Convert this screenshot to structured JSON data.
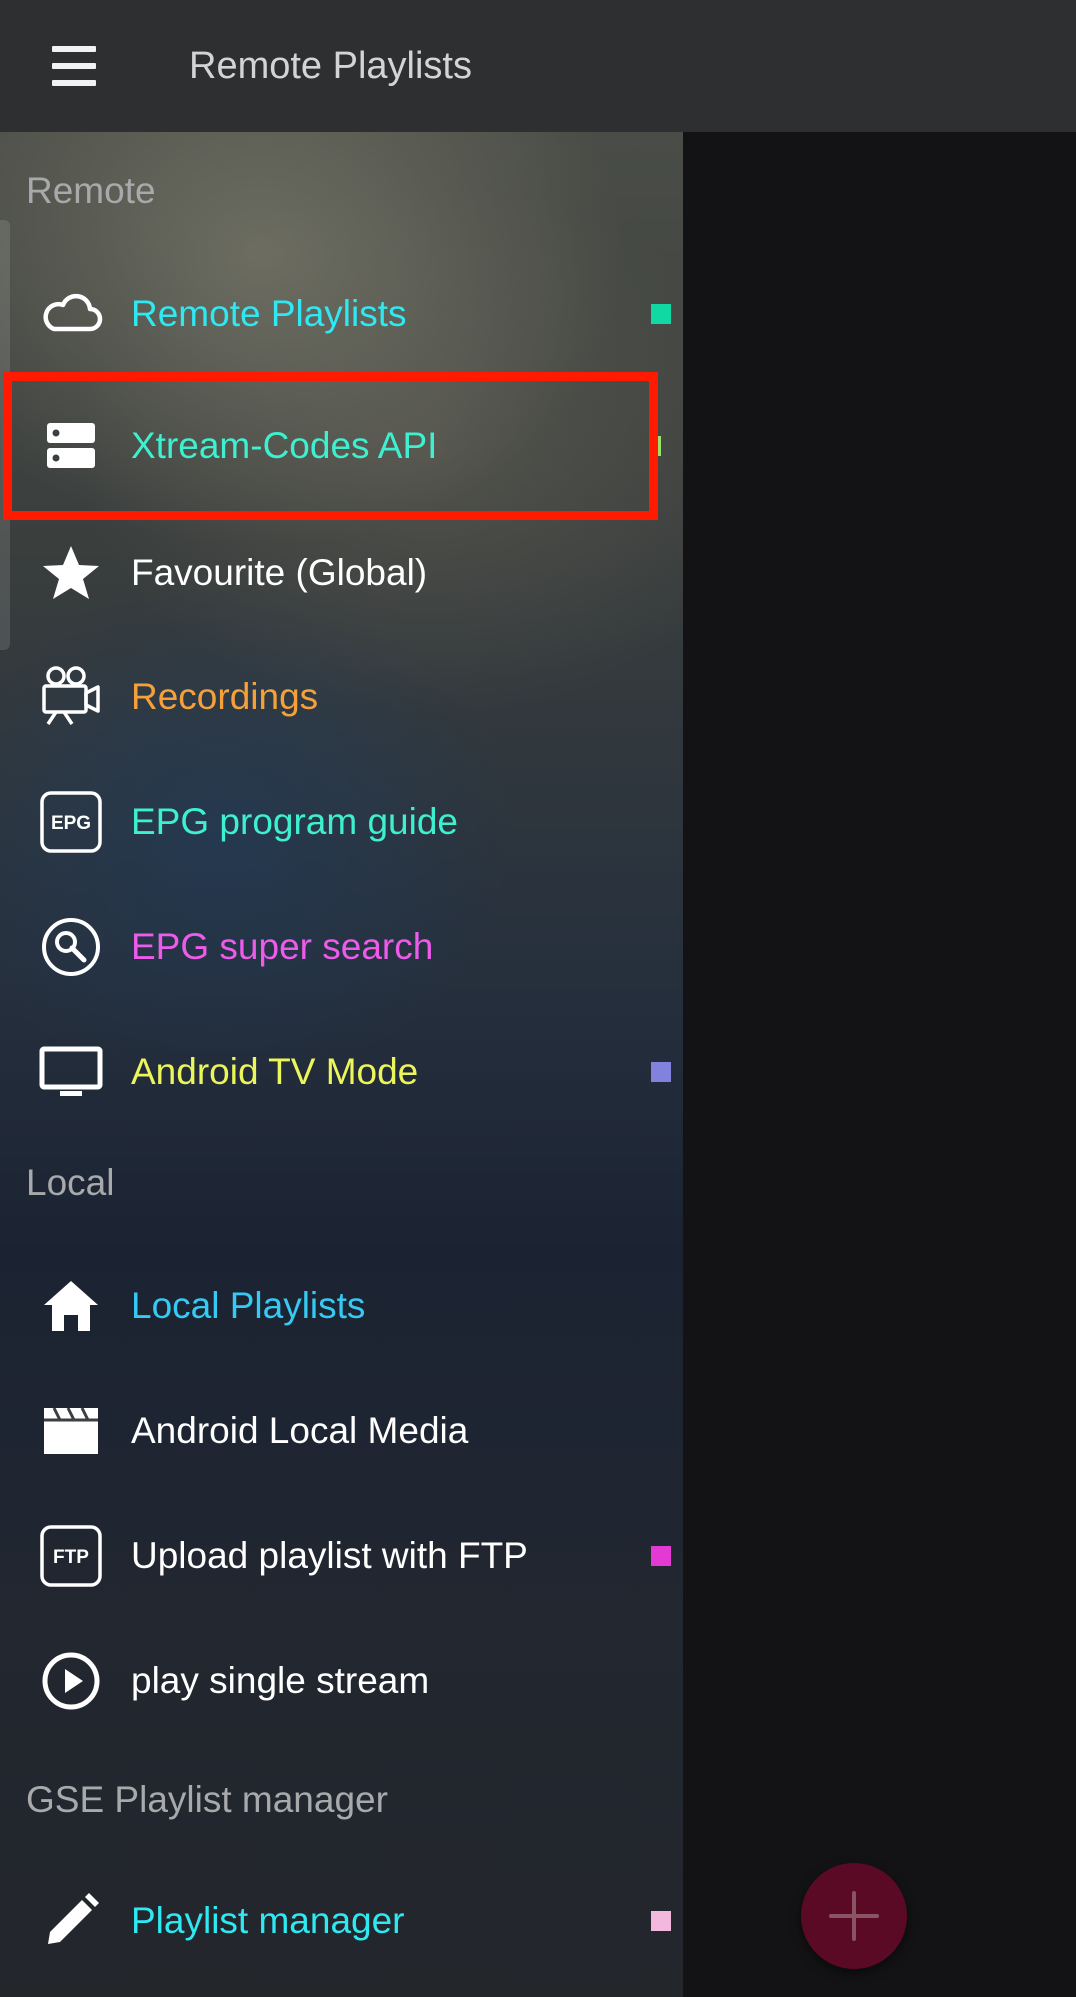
{
  "appbar": {
    "title": "Remote Playlists",
    "menu_icon": "hamburger-menu-icon"
  },
  "sections": {
    "remote": "Remote",
    "local": "Local",
    "gse": "GSE Playlist manager"
  },
  "items": [
    {
      "id": "remote-playlists",
      "label": "Remote Playlists",
      "icon": "cloud-icon",
      "color": "#2ee8f2",
      "marker": "#10d9a3"
    },
    {
      "id": "xtream-codes-api",
      "label": "Xtream-Codes API",
      "icon": "server-icon",
      "color": "#3ef0cf",
      "marker": "#9be36a",
      "highlighted": true
    },
    {
      "id": "favourite-global",
      "label": "Favourite (Global)",
      "icon": "star-icon",
      "color": "#ffffff"
    },
    {
      "id": "recordings",
      "label": "Recordings",
      "icon": "movie-camera-icon",
      "color": "#f6a03a"
    },
    {
      "id": "epg-program-guide",
      "label": "EPG program guide",
      "icon": "epg-icon",
      "color": "#3ef0cf",
      "icon_text": "EPG"
    },
    {
      "id": "epg-super-search",
      "label": "EPG super search",
      "icon": "search-icon",
      "color": "#ec5bea"
    },
    {
      "id": "android-tv-mode",
      "label": "Android TV Mode",
      "icon": "tv-icon",
      "color": "#ecf55a",
      "marker": "#8181de"
    },
    {
      "id": "local-playlists",
      "label": "Local Playlists",
      "icon": "home-icon",
      "color": "#36c9f4"
    },
    {
      "id": "android-local-media",
      "label": "Android Local Media",
      "icon": "clapperboard-icon",
      "color": "#ffffff"
    },
    {
      "id": "upload-playlist-ftp",
      "label": "Upload playlist with FTP",
      "icon": "ftp-icon",
      "color": "#ffffff",
      "marker": "#e33ad3",
      "icon_text": "FTP"
    },
    {
      "id": "play-single-stream",
      "label": "play single stream",
      "icon": "play-circle-icon",
      "color": "#ffffff"
    },
    {
      "id": "playlist-manager",
      "label": "Playlist manager",
      "icon": "pencil-icon",
      "color": "#2ee8f2",
      "marker": "#f2b8de"
    }
  ],
  "fab": {
    "icon": "plus-icon",
    "color": "#5a0a24"
  }
}
